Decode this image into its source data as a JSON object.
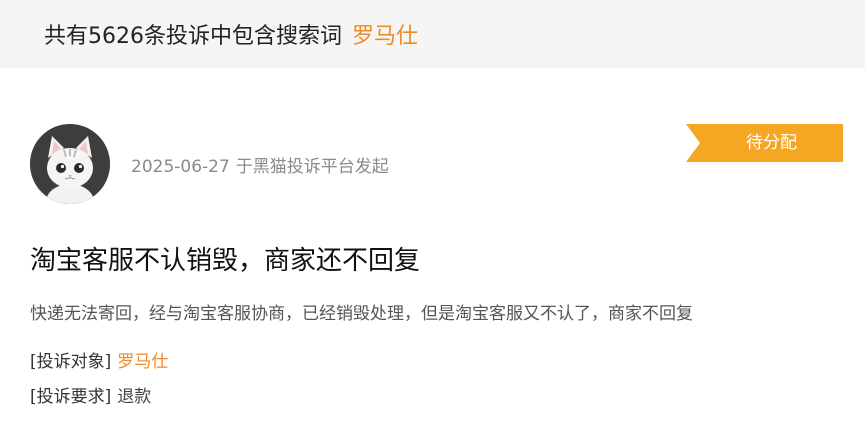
{
  "header": {
    "prefix": "共有5626条投诉中包含搜索词",
    "keyword": "罗马仕"
  },
  "complaint": {
    "avatar_icon": "cat-avatar-icon",
    "date": "2025-06-27",
    "source": "于黑猫投诉平台发起",
    "status": "待分配",
    "status_color": "#f5a623",
    "title": "淘宝客服不认销毁，商家还不回复",
    "description": "快递无法寄回，经与淘宝客服协商，已经销毁处理，但是淘宝客服又不认了，商家不回复",
    "target_label": "[投诉对象]",
    "target_value": "罗马仕",
    "request_label": "[投诉要求]",
    "request_value": "退款"
  },
  "colors": {
    "accent": "#f08a24",
    "badge": "#f5a623"
  }
}
